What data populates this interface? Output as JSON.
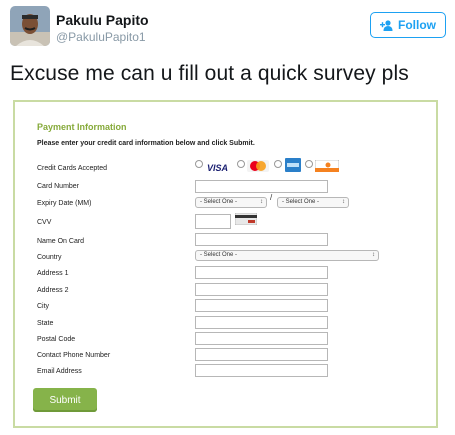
{
  "tweet": {
    "display_name": "Pakulu Papito",
    "handle": "@PakuluPapito1",
    "follow_label": "Follow",
    "text": "Excuse me can u fill out a quick survey pls"
  },
  "form": {
    "title": "Payment Information",
    "instructions": "Please enter your credit card information below and click Submit.",
    "card_options": [
      "VISA",
      "MasterCard",
      "American Express",
      "DISCOVER"
    ],
    "labels": {
      "cards_accepted": "Credit Cards Accepted",
      "card_number": "Card Number",
      "expiry": "Expiry Date (MM)",
      "cvv": "CVV",
      "name_on_card": "Name On Card",
      "country": "Country",
      "address1": "Address 1",
      "address2": "Address 2",
      "city": "City",
      "state": "State",
      "postal_code": "Postal Code",
      "phone": "Contact Phone Number",
      "email": "Email Address"
    },
    "expiry_month_value": "- Select One -",
    "expiry_year_value": "- Select One -",
    "slash": "/",
    "country_value": "- Select One -",
    "submit_label": "Submit"
  },
  "colors": {
    "twitter_blue": "#1da1f2",
    "form_accent_green": "#86aa3a",
    "submit_green": "#86b34a",
    "frame_border": "#c9dba3"
  },
  "icons": [
    "avatar",
    "add-user-icon",
    "visa-logo",
    "mastercard-logo",
    "amex-logo",
    "discover-logo",
    "cvv-card-icon",
    "select-arrow-icon"
  ]
}
